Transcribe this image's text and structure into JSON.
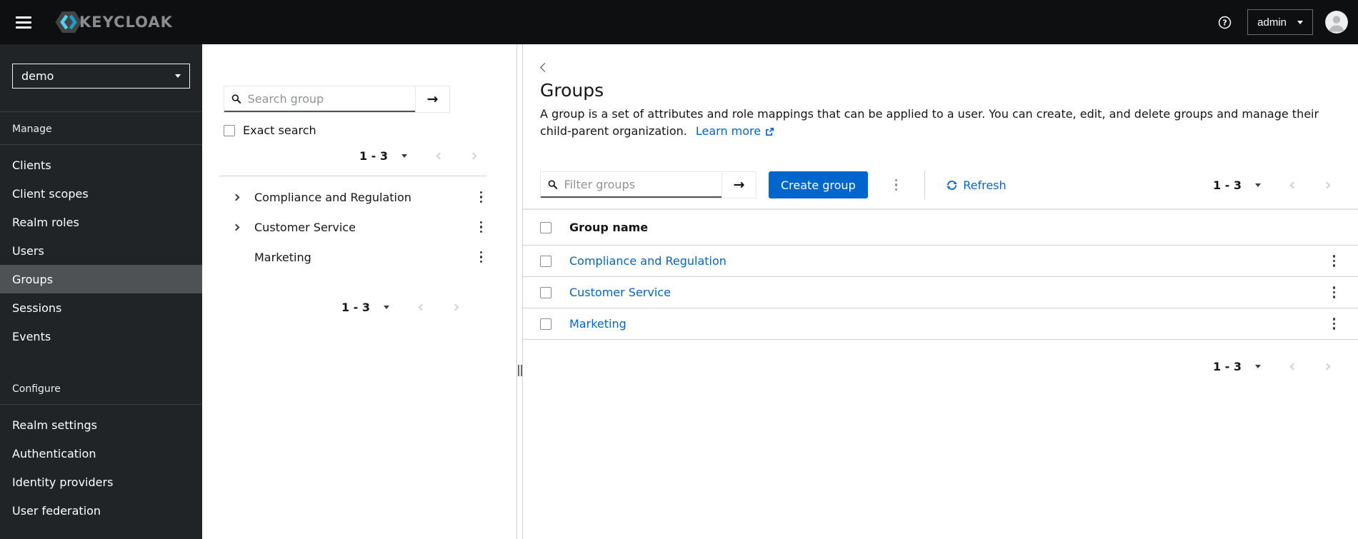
{
  "topbar": {
    "brand": "KEYCLOAK",
    "username": "admin"
  },
  "sidebar": {
    "realm": "demo",
    "manage_label": "Manage",
    "manage_items": [
      "Clients",
      "Client scopes",
      "Realm roles",
      "Users",
      "Groups",
      "Sessions",
      "Events"
    ],
    "selected_item": "Groups",
    "configure_label": "Configure",
    "configure_items": [
      "Realm settings",
      "Authentication",
      "Identity providers",
      "User federation"
    ]
  },
  "tree_panel": {
    "search_placeholder": "Search group",
    "exact_search_label": "Exact search",
    "pagination_range": "1 - 3",
    "groups": [
      {
        "name": "Compliance and Regulation",
        "expandable": true
      },
      {
        "name": "Customer Service",
        "expandable": true
      },
      {
        "name": "Marketing",
        "expandable": false
      }
    ]
  },
  "main": {
    "title": "Groups",
    "description": "A group is a set of attributes and role mappings that can be applied to a user. You can create, edit, and delete groups and manage their child-parent organization.",
    "learn_more_label": "Learn more",
    "filter_placeholder": "Filter groups",
    "create_button_label": "Create group",
    "refresh_label": "Refresh",
    "pagination_range": "1 - 3",
    "table": {
      "header": "Group name",
      "rows": [
        "Compliance and Regulation",
        "Customer Service",
        "Marketing"
      ]
    }
  },
  "icons": {
    "arrow_right": "→"
  },
  "colors": {
    "accent": "#0066cc",
    "link": "#0066cc",
    "topbar_bg": "#0e0f10",
    "sidebar_bg": "#212427",
    "sidebar_selected": "#4f5255",
    "text": "#151515",
    "muted": "#6a6e73",
    "border": "#d2d2d2",
    "logo_cyan": "#53d1ec",
    "logo_blue": "#1b9ec9"
  }
}
